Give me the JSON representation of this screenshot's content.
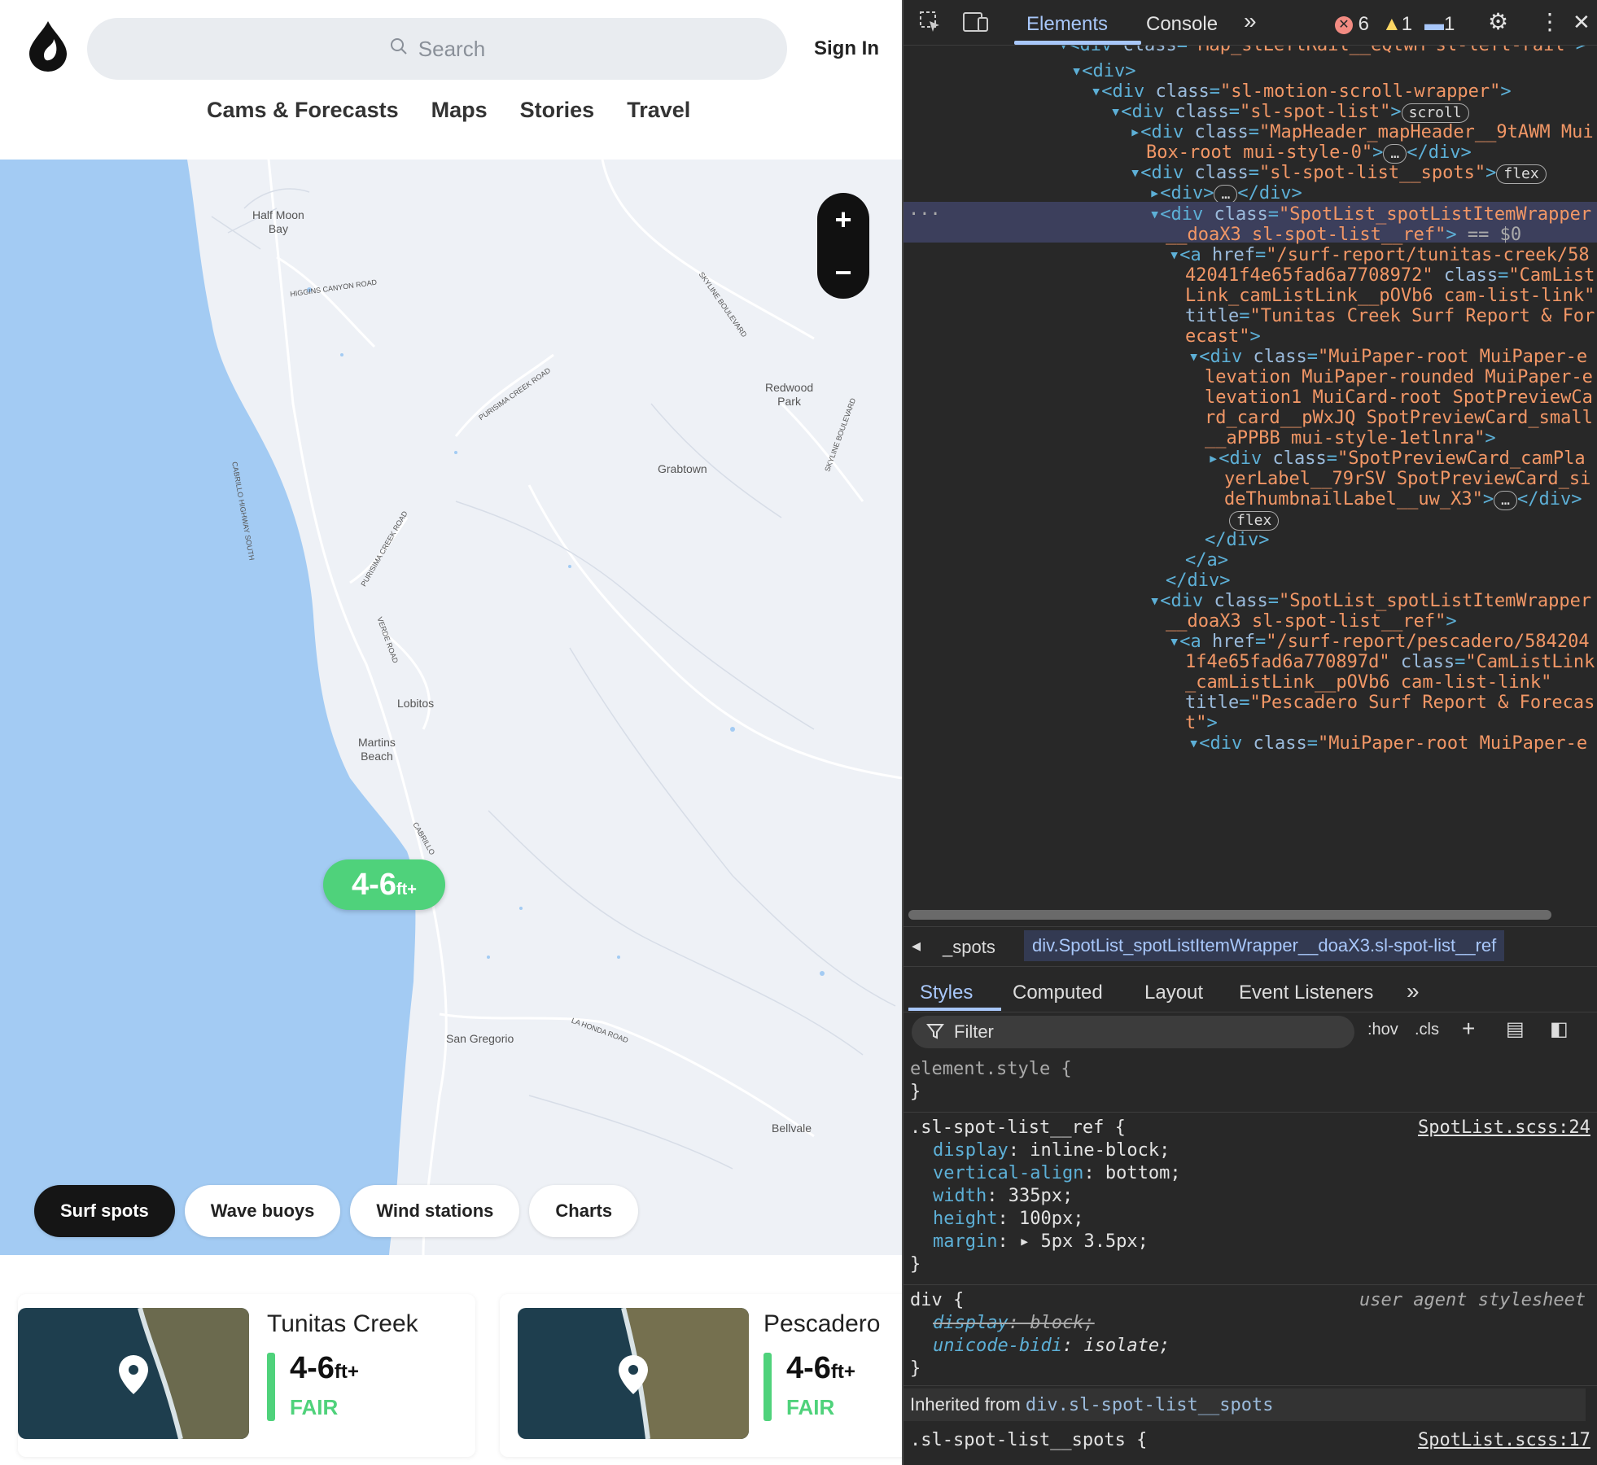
{
  "header": {
    "logo_icon": "surfline-drop-logo-icon",
    "search_placeholder": "Search",
    "sign_in": "Sign In",
    "nav": [
      "Cams & Forecasts",
      "Maps",
      "Stories",
      "Travel"
    ]
  },
  "map": {
    "labels": [
      "Half Moon\nBay",
      "Redwood\nPark",
      "Grabtown",
      "Lobitos",
      "Martins\nBeach",
      "San Gregorio",
      "Bellvale"
    ],
    "road_labels": [
      "HIGGINS CANYON ROAD",
      "SKYLINE BOULEVARD",
      "PURISIMA CREEK ROAD",
      "PURISIMA CREEK ROAD",
      "CABRILLO HIGHWAY SOUTH",
      "VERDE ROAD",
      "CABRILLO",
      "SKYLINE BOULEVARD",
      "LA HONDA ROAD"
    ],
    "zoom_in": "+",
    "zoom_out": "−",
    "pill": {
      "value": "4-6",
      "unit": "ft+",
      "color": "#4fd27b"
    },
    "filters": [
      "Surf spots",
      "Wave buoys",
      "Wind stations",
      "Charts"
    ],
    "active_filter": "Surf spots",
    "ocean_color": "#a3cbf3",
    "land_color": "#eef1f6"
  },
  "spots": [
    {
      "name": "Tunitas Creek",
      "height": "4-6",
      "unit": "ft+",
      "condition": "FAIR"
    },
    {
      "name": "Pescadero",
      "height": "4-6",
      "unit": "ft+",
      "condition": "FAIR"
    }
  ],
  "devtools": {
    "tabs": [
      "Elements",
      "Console"
    ],
    "more": "»",
    "errors": "6",
    "warnings": "1",
    "messages": "1",
    "breadcrumbs": [
      "_spots",
      "div.SpotList_spotListItemWrapper__doaX3.sl-spot-list__ref"
    ],
    "style_tabs": [
      "Styles",
      "Computed",
      "Layout",
      "Event Listeners"
    ],
    "filter_placeholder": "Filter",
    "hov": ":hov",
    "cls": ".cls",
    "inherited_label": "Inherited from",
    "inherited_selector": "div.sl-spot-list__spots"
  }
}
